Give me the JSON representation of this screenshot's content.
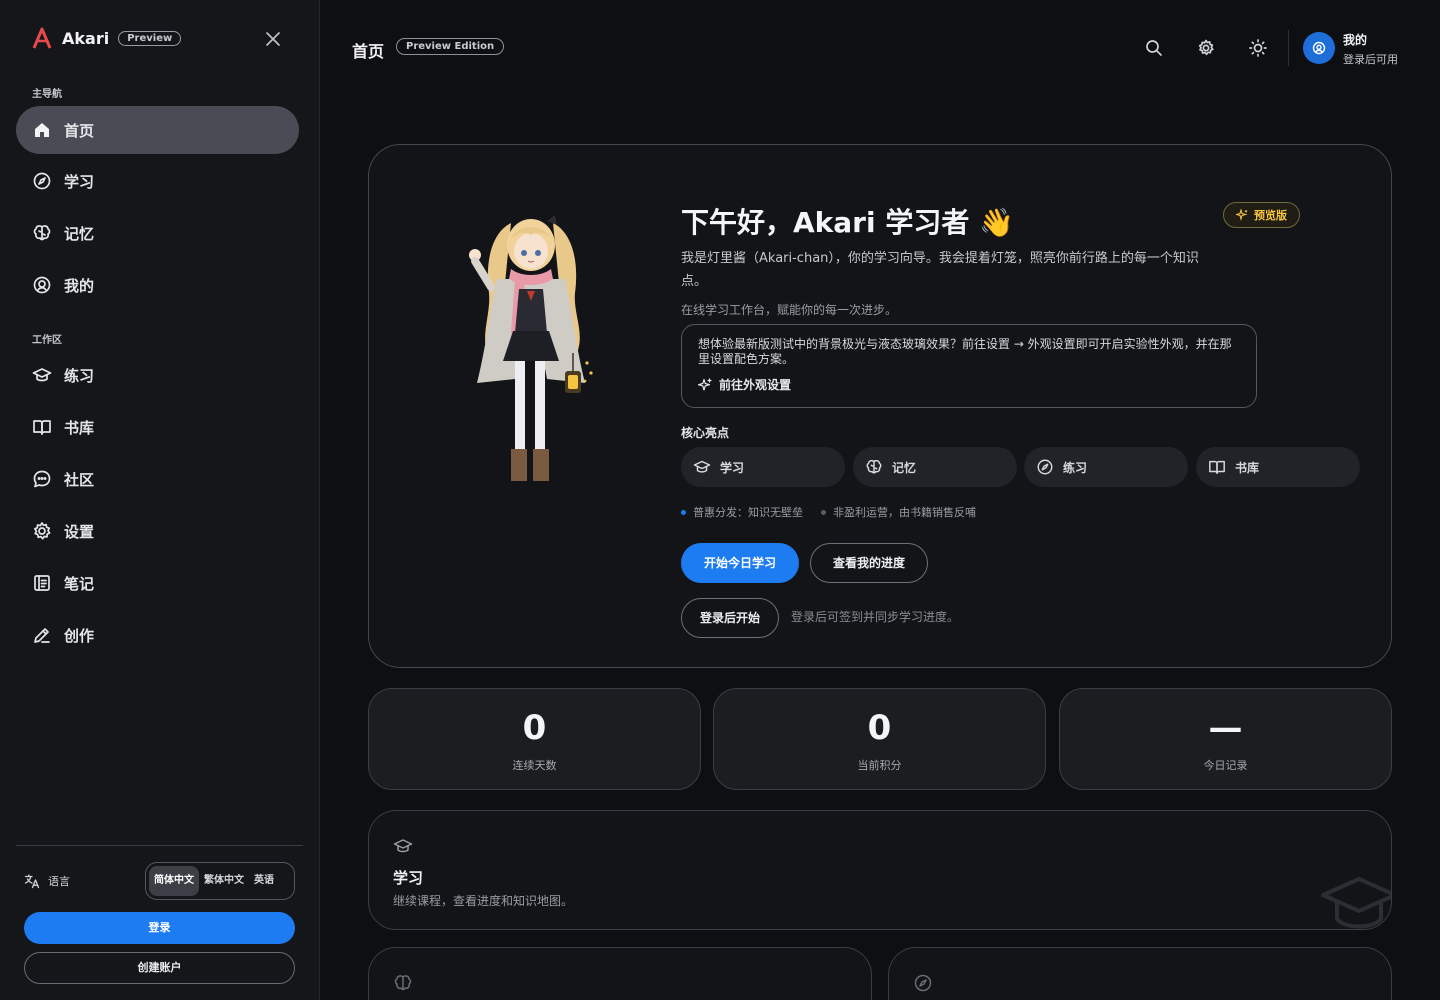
{
  "brand": {
    "name": "Akari",
    "badge": "Preview"
  },
  "sidebar": {
    "main_section": "主导航",
    "main_items": [
      {
        "label": "首页",
        "icon": "home-icon",
        "active": true
      },
      {
        "label": "学习",
        "icon": "compass-icon"
      },
      {
        "label": "记忆",
        "icon": "brain-icon"
      },
      {
        "label": "我的",
        "icon": "user-circle-icon"
      }
    ],
    "work_section": "工作区",
    "work_items": [
      {
        "label": "练习",
        "icon": "graduation-cap-icon"
      },
      {
        "label": "书库",
        "icon": "book-open-icon"
      },
      {
        "label": "社区",
        "icon": "chat-bubble-icon"
      },
      {
        "label": "设置",
        "icon": "gear-icon"
      },
      {
        "label": "笔记",
        "icon": "notebook-icon"
      },
      {
        "label": "创作",
        "icon": "pencil-icon"
      }
    ],
    "language": {
      "label": "语言",
      "options": [
        "简体中文",
        "繁体中文",
        "英语"
      ],
      "selected": "简体中文"
    },
    "login_label": "登录",
    "register_label": "创建账户"
  },
  "topbar": {
    "title": "首页",
    "badge": "Preview Edition",
    "user": {
      "name": "我的",
      "subtitle": "登录后可用"
    }
  },
  "hero": {
    "title": "下午好，Akari 学习者 👋",
    "preview_badge": "预览版",
    "description": "我是灯里酱（Akari-chan），你的学习向导。我会提着灯笼，照亮你前行路上的每一个知识点。",
    "subtitle": "在线学习工作台，赋能你的每一次进步。",
    "notice_text": "想体验最新版测试中的背景极光与液态玻璃效果？前往设置 → 外观设置即可开启实验性外观，并在那里设置配色方案。",
    "notice_link": "前往外观设置",
    "highlights_title": "核心亮点",
    "highlights": [
      {
        "label": "学习",
        "icon": "graduation-cap-icon"
      },
      {
        "label": "记忆",
        "icon": "brain-icon"
      },
      {
        "label": "练习",
        "icon": "compass-icon"
      },
      {
        "label": "书库",
        "icon": "book-open-icon"
      }
    ],
    "bullets": [
      "普惠分发：知识无壁垒",
      "非盈利运营，由书籍销售反哺"
    ],
    "primary_button": "开始今日学习",
    "secondary_button": "查看我的进度",
    "login_button": "登录后开始",
    "login_hint": "登录后可签到并同步学习进度。"
  },
  "stats": [
    {
      "value": "0",
      "label": "连续天数"
    },
    {
      "value": "0",
      "label": "当前积分"
    },
    {
      "value": "—",
      "label": "今日记录"
    }
  ],
  "feature_card": {
    "title": "学习",
    "description": "继续课程，查看进度和知识地图。"
  },
  "colors": {
    "accent": "#1d7cf2",
    "preview_gold": "#f5c542",
    "brand_red": "#e5484d"
  }
}
